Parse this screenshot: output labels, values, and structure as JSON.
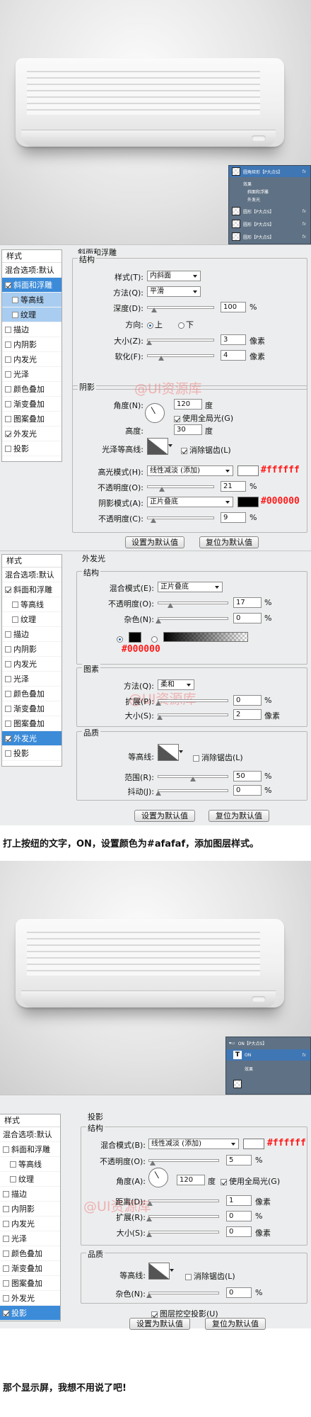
{
  "watermark": "@UI资源库",
  "scene1": {
    "layers": [
      {
        "name": "圆角矩形【P大点S】",
        "fx": "fx"
      },
      {
        "name": "效果"
      },
      {
        "name": "斜面和浮雕"
      },
      {
        "name": "外发光"
      },
      {
        "name": "圆形【P大点S】",
        "fx": "fx"
      },
      {
        "name": "圆形【P大点S】",
        "fx": "fx"
      },
      {
        "name": "圆形【P大点S】",
        "fx": "fx"
      }
    ]
  },
  "panel1": {
    "sidebar": {
      "header": "样式",
      "items": [
        {
          "label": "混合选项:默认",
          "checkbox": false,
          "checked": false,
          "sub": false
        },
        {
          "label": "斜面和浮雕",
          "checkbox": true,
          "checked": true,
          "sub": false
        },
        {
          "label": "等高线",
          "checkbox": true,
          "checked": false,
          "sub": true
        },
        {
          "label": "纹理",
          "checkbox": true,
          "checked": false,
          "sub": true
        },
        {
          "label": "描边",
          "checkbox": true,
          "checked": false,
          "sub": false
        },
        {
          "label": "内阴影",
          "checkbox": true,
          "checked": false,
          "sub": false
        },
        {
          "label": "内发光",
          "checkbox": true,
          "checked": false,
          "sub": false
        },
        {
          "label": "光泽",
          "checkbox": true,
          "checked": false,
          "sub": false
        },
        {
          "label": "颜色叠加",
          "checkbox": true,
          "checked": false,
          "sub": false
        },
        {
          "label": "渐变叠加",
          "checkbox": true,
          "checked": false,
          "sub": false
        },
        {
          "label": "图案叠加",
          "checkbox": true,
          "checked": false,
          "sub": false
        },
        {
          "label": "外发光",
          "checkbox": true,
          "checked": true,
          "sub": false
        },
        {
          "label": "投影",
          "checkbox": true,
          "checked": false,
          "sub": false
        }
      ]
    },
    "title": "斜面和浮雕",
    "structure": {
      "title": "结构",
      "style_label": "样式(T):",
      "style_value": "内斜面",
      "method_label": "方法(Q):",
      "method_value": "平滑",
      "depth_label": "深度(D):",
      "depth_value": "100",
      "depth_unit": "%",
      "depth_pct": 0.1,
      "direction_label": "方向:",
      "dir_up": "上",
      "dir_down": "下",
      "size_label": "大小(Z):",
      "size_value": "3",
      "size_unit": "像素",
      "size_pct": 0.02,
      "soften_label": "软化(F):",
      "soften_value": "4",
      "soften_unit": "像素",
      "soften_pct": 0.2
    },
    "shading": {
      "title": "阴影",
      "angle_label": "角度(N):",
      "angle_value": "120",
      "angle_unit": "度",
      "global_light": "使用全局光(G)",
      "altitude_label": "高度:",
      "altitude_value": "30",
      "altitude_unit": "度",
      "gloss_label": "光泽等高线:",
      "antialias": "消除锯齿(L)",
      "highlight_label": "高光模式(H):",
      "highlight_value": "线性减淡 (添加)",
      "highlight_hex": "#ffffff",
      "highlight_color": "#ffffff",
      "hl_opacity_label": "不透明度(O):",
      "hl_opacity_value": "21",
      "hl_opacity_unit": "%",
      "hl_opacity_pct": 0.21,
      "shadow_label": "阴影模式(A):",
      "shadow_value": "正片叠底",
      "shadow_hex": "#000000",
      "shadow_color": "#000000",
      "sh_opacity_label": "不透明度(C):",
      "sh_opacity_value": "9",
      "sh_opacity_unit": "%",
      "sh_opacity_pct": 0.09
    },
    "btn_default": "设置为默认值",
    "btn_reset": "复位为默认值"
  },
  "panel2": {
    "sidebar": {
      "header": "样式",
      "items": [
        {
          "label": "混合选项:默认",
          "checkbox": false,
          "checked": false,
          "sub": false
        },
        {
          "label": "斜面和浮雕",
          "checkbox": true,
          "checked": true,
          "sub": false
        },
        {
          "label": "等高线",
          "checkbox": true,
          "checked": false,
          "sub": true
        },
        {
          "label": "纹理",
          "checkbox": true,
          "checked": false,
          "sub": true
        },
        {
          "label": "描边",
          "checkbox": true,
          "checked": false,
          "sub": false
        },
        {
          "label": "内阴影",
          "checkbox": true,
          "checked": false,
          "sub": false
        },
        {
          "label": "内发光",
          "checkbox": true,
          "checked": false,
          "sub": false
        },
        {
          "label": "光泽",
          "checkbox": true,
          "checked": false,
          "sub": false
        },
        {
          "label": "颜色叠加",
          "checkbox": true,
          "checked": false,
          "sub": false
        },
        {
          "label": "渐变叠加",
          "checkbox": true,
          "checked": false,
          "sub": false
        },
        {
          "label": "图案叠加",
          "checkbox": true,
          "checked": false,
          "sub": false
        },
        {
          "label": "外发光",
          "checkbox": true,
          "checked": true,
          "sub": false
        },
        {
          "label": "投影",
          "checkbox": true,
          "checked": false,
          "sub": false
        }
      ]
    },
    "title": "外发光",
    "structure": {
      "title": "结构",
      "blend_label": "混合模式(E):",
      "blend_value": "正片叠底",
      "opacity_label": "不透明度(O):",
      "opacity_value": "17",
      "opacity_unit": "%",
      "opacity_pct": 0.17,
      "noise_label": "杂色(N):",
      "noise_value": "0",
      "noise_unit": "%",
      "noise_pct": 0,
      "color_hex": "#000000",
      "color": "#000000"
    },
    "elements": {
      "title": "图素",
      "technique_label": "方法(Q):",
      "technique_value": "柔和",
      "spread_label": "扩展(P):",
      "spread_value": "0",
      "spread_unit": "%",
      "spread_pct": 0,
      "size_label": "大小(S):",
      "size_value": "2",
      "size_unit": "像素",
      "size_pct": 0.02
    },
    "quality": {
      "title": "品质",
      "contour_label": "等高线:",
      "antialias": "消除锯齿(L)",
      "range_label": "范围(R):",
      "range_value": "50",
      "range_unit": "%",
      "range_pct": 0.5,
      "jitter_label": "抖动(J):",
      "jitter_value": "0",
      "jitter_unit": "%",
      "jitter_pct": 0
    },
    "btn_default": "设置为默认值",
    "btn_reset": "复位为默认值"
  },
  "caption1": "打上按纽的文字，ON，设置颜色为#afafaf，添加图层样式。",
  "scene2": {
    "layers": [
      {
        "name": "ON【P大点S】"
      },
      {
        "name": "ON",
        "fx": "fx"
      },
      {
        "name": "效果"
      },
      {
        "name": ""
      }
    ]
  },
  "panel3": {
    "sidebar": {
      "header": "样式",
      "items": [
        {
          "label": "混合选项:默认",
          "checkbox": false,
          "checked": false,
          "sub": false
        },
        {
          "label": "斜面和浮雕",
          "checkbox": true,
          "checked": false,
          "sub": false
        },
        {
          "label": "等高线",
          "checkbox": true,
          "checked": false,
          "sub": true
        },
        {
          "label": "纹理",
          "checkbox": true,
          "checked": false,
          "sub": true
        },
        {
          "label": "描边",
          "checkbox": true,
          "checked": false,
          "sub": false
        },
        {
          "label": "内阴影",
          "checkbox": true,
          "checked": false,
          "sub": false
        },
        {
          "label": "内发光",
          "checkbox": true,
          "checked": false,
          "sub": false
        },
        {
          "label": "光泽",
          "checkbox": true,
          "checked": false,
          "sub": false
        },
        {
          "label": "颜色叠加",
          "checkbox": true,
          "checked": false,
          "sub": false
        },
        {
          "label": "渐变叠加",
          "checkbox": true,
          "checked": false,
          "sub": false
        },
        {
          "label": "图案叠加",
          "checkbox": true,
          "checked": false,
          "sub": false
        },
        {
          "label": "外发光",
          "checkbox": true,
          "checked": false,
          "sub": false
        },
        {
          "label": "投影",
          "checkbox": true,
          "checked": true,
          "sub": false
        }
      ]
    },
    "title": "投影",
    "structure": {
      "title": "结构",
      "blend_label": "混合模式(B):",
      "blend_value": "线性减淡 (添加)",
      "hex": "#ffffff",
      "color": "#ffffff",
      "opacity_label": "不透明度(O):",
      "opacity_value": "5",
      "opacity_unit": "%",
      "opacity_pct": 0.05,
      "angle_label": "角度(A):",
      "angle_value": "120",
      "angle_unit": "度",
      "global_light": "使用全局光(G)",
      "distance_label": "距离(D):",
      "distance_value": "1",
      "distance_unit": "像素",
      "distance_pct": 0.01,
      "spread_label": "扩展(R):",
      "spread_value": "0",
      "spread_unit": "%",
      "spread_pct": 0,
      "size_label": "大小(S):",
      "size_value": "0",
      "size_unit": "像素",
      "size_pct": 0
    },
    "quality": {
      "title": "品质",
      "contour_label": "等高线:",
      "antialias": "消除锯齿(L)",
      "noise_label": "杂色(N):",
      "noise_value": "0",
      "noise_unit": "%",
      "noise_pct": 0,
      "knockout": "图层挖空投影(U)"
    },
    "btn_default": "设置为默认值",
    "btn_reset": "复位为默认值"
  },
  "caption2": "那个显示屏，我想不用说了吧!"
}
